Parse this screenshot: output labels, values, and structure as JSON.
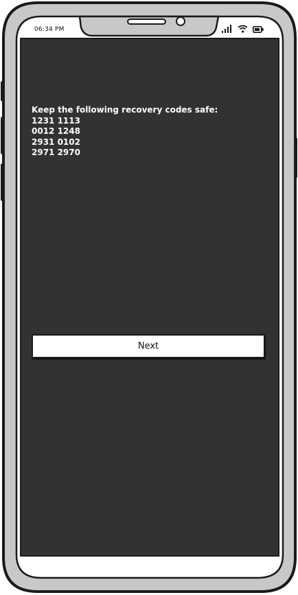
{
  "status_bar": {
    "time": "06:34 PM",
    "icons": [
      "signal-icon",
      "wifi-icon",
      "battery-icon"
    ]
  },
  "message": {
    "heading": "Keep the following recovery codes safe:",
    "codes": [
      "1231 1113",
      "0012 1248",
      "2931 0102",
      "2971 2970"
    ]
  },
  "actions": {
    "next_label": "Next"
  },
  "colors": {
    "screen_background": "#323232",
    "frame_body": "#c8c8c8",
    "frame_outline": "#1a1a1a",
    "text": "#ffffff",
    "button_background": "#ffffff"
  }
}
